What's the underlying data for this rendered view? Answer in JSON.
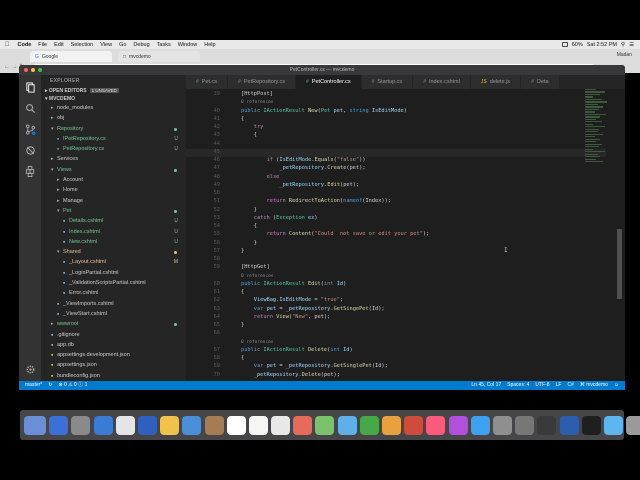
{
  "menubar": {
    "items": [
      "Code",
      "File",
      "Edit",
      "Selection",
      "View",
      "Go",
      "Debug",
      "Tasks",
      "Window",
      "Help"
    ],
    "battery": "60%",
    "clock": "Sat 2:52 PM"
  },
  "browser": {
    "tab1": "Google",
    "tab2": "mvcdemo",
    "user": "Madan"
  },
  "window": {
    "title": "PetController.cs — mvcdemo"
  },
  "sidebar": {
    "header": "EXPLORER",
    "open_editors": "OPEN EDITORS",
    "unsaved": "1 UNSAVED",
    "project": "MVCDEMO",
    "tree": [
      {
        "label": "node_modules",
        "indent": 1,
        "caret": "▸",
        "status": ""
      },
      {
        "label": "obj",
        "indent": 1,
        "caret": "▸",
        "status": ""
      },
      {
        "label": "Repository",
        "indent": 1,
        "caret": "▾",
        "status": "dot",
        "color": "#73c991"
      },
      {
        "label": "IPetRepository.cs",
        "indent": 2,
        "caret": "",
        "status": "U",
        "color": "#73c991"
      },
      {
        "label": "PetRepository.cs",
        "indent": 2,
        "caret": "",
        "status": "U",
        "color": "#73c991"
      },
      {
        "label": "Services",
        "indent": 1,
        "caret": "▸",
        "status": ""
      },
      {
        "label": "Views",
        "indent": 1,
        "caret": "▾",
        "status": "dot",
        "color": "#73c991"
      },
      {
        "label": "Account",
        "indent": 2,
        "caret": "▸",
        "status": ""
      },
      {
        "label": "Home",
        "indent": 2,
        "caret": "▸",
        "status": ""
      },
      {
        "label": "Manage",
        "indent": 2,
        "caret": "▸",
        "status": ""
      },
      {
        "label": "Pet",
        "indent": 2,
        "caret": "▾",
        "status": "dot",
        "color": "#73c991"
      },
      {
        "label": "Details.cshtml",
        "indent": 3,
        "caret": "",
        "status": "U",
        "color": "#73c991"
      },
      {
        "label": "Index.cshtml",
        "indent": 3,
        "caret": "",
        "status": "U",
        "color": "#73c991"
      },
      {
        "label": "New.cshtml",
        "indent": 3,
        "caret": "",
        "status": "U",
        "color": "#73c991"
      },
      {
        "label": "Shared",
        "indent": 2,
        "caret": "▾",
        "status": "dot",
        "color": "#e2c08d"
      },
      {
        "label": "_Layout.cshtml",
        "indent": 3,
        "caret": "",
        "status": "M",
        "color": "#e2c08d"
      },
      {
        "label": "_LoginPartial.cshtml",
        "indent": 3,
        "caret": "",
        "status": ""
      },
      {
        "label": "_ValidationScriptsPartial.cshtml",
        "indent": 3,
        "caret": "",
        "status": ""
      },
      {
        "label": "Error.cshtml",
        "indent": 3,
        "caret": "",
        "status": ""
      },
      {
        "label": "_ViewImports.cshtml",
        "indent": 2,
        "caret": "",
        "status": ""
      },
      {
        "label": "_ViewStart.cshtml",
        "indent": 2,
        "caret": "",
        "status": ""
      },
      {
        "label": "wwwroot",
        "indent": 1,
        "caret": "▸",
        "status": "dot",
        "color": "#73c991"
      },
      {
        "label": ".gitignore",
        "indent": 1,
        "caret": "",
        "status": ""
      },
      {
        "label": "app.db",
        "indent": 1,
        "caret": "",
        "status": ""
      },
      {
        "label": "appsettings.development.json",
        "indent": 1,
        "caret": "",
        "status": ""
      },
      {
        "label": "appsettings.json",
        "indent": 1,
        "caret": "",
        "status": ""
      },
      {
        "label": "bundleconfig.json",
        "indent": 1,
        "caret": "",
        "status": ""
      }
    ]
  },
  "tabs": [
    {
      "label": "Pet.cs",
      "type": "cs",
      "active": false
    },
    {
      "label": "PetRepository.cs",
      "type": "cs",
      "active": false
    },
    {
      "label": "PetController.cs",
      "type": "cs",
      "active": true
    },
    {
      "label": "Startup.cs",
      "type": "cs",
      "active": false
    },
    {
      "label": "Index.cshtml",
      "type": "cs",
      "active": false
    },
    {
      "label": "delete.js",
      "type": "js",
      "active": false
    },
    {
      "label": "Deta",
      "type": "cs",
      "active": false
    }
  ],
  "code": [
    {
      "n": "39",
      "ind": 4,
      "toks": [
        [
          "pl",
          "[HttpPost]"
        ]
      ]
    },
    {
      "n": "",
      "ind": 4,
      "ref": "0 references"
    },
    {
      "n": "40",
      "ind": 4,
      "toks": [
        [
          "kw",
          "public "
        ],
        [
          "ty",
          "IActionResult "
        ],
        [
          "fn",
          "New"
        ],
        [
          "pl",
          "("
        ],
        [
          "ty",
          "Pet "
        ],
        [
          "vr",
          "pet"
        ],
        [
          "pl",
          ", "
        ],
        [
          "kw",
          "string "
        ],
        [
          "vr",
          "IsEditMode"
        ],
        [
          "pl",
          ")"
        ]
      ]
    },
    {
      "n": "41",
      "ind": 4,
      "toks": [
        [
          "pl",
          "{"
        ]
      ]
    },
    {
      "n": "42",
      "ind": 8,
      "toks": [
        [
          "kc",
          "try"
        ]
      ]
    },
    {
      "n": "43",
      "ind": 8,
      "toks": [
        [
          "pl",
          "{"
        ]
      ]
    },
    {
      "n": "44",
      "ind": 12,
      "toks": [
        [
          "pl",
          ""
        ]
      ]
    },
    {
      "n": "45",
      "ind": 12,
      "toks": [
        [
          "pl",
          ""
        ]
      ],
      "cur": true
    },
    {
      "n": "46",
      "ind": 12,
      "toks": [
        [
          "kc",
          "if "
        ],
        [
          "pl",
          "("
        ],
        [
          "vr",
          "IsEditMode"
        ],
        [
          "pl",
          "."
        ],
        [
          "fn",
          "Equals"
        ],
        [
          "pl",
          "("
        ],
        [
          "st",
          "\"false\""
        ],
        [
          "pl",
          "))"
        ]
      ]
    },
    {
      "n": "47",
      "ind": 16,
      "toks": [
        [
          "vr",
          "_petRepository"
        ],
        [
          "pl",
          "."
        ],
        [
          "fn",
          "Create"
        ],
        [
          "pl",
          "(pet);"
        ]
      ]
    },
    {
      "n": "48",
      "ind": 12,
      "toks": [
        [
          "kc",
          "else"
        ]
      ]
    },
    {
      "n": "49",
      "ind": 16,
      "toks": [
        [
          "vr",
          "_petRepository"
        ],
        [
          "pl",
          "."
        ],
        [
          "fn",
          "Edit"
        ],
        [
          "pl",
          "(pet);"
        ]
      ]
    },
    {
      "n": "50",
      "ind": 12,
      "toks": [
        [
          "pl",
          ""
        ]
      ]
    },
    {
      "n": "51",
      "ind": 12,
      "toks": [
        [
          "kc",
          "return "
        ],
        [
          "fn",
          "RedirectToAction"
        ],
        [
          "pl",
          "("
        ],
        [
          "kw",
          "nameof"
        ],
        [
          "pl",
          "(Index));"
        ]
      ]
    },
    {
      "n": "52",
      "ind": 8,
      "toks": [
        [
          "pl",
          "}"
        ]
      ]
    },
    {
      "n": "53",
      "ind": 8,
      "toks": [
        [
          "kc",
          "catch "
        ],
        [
          "pl",
          "("
        ],
        [
          "ty",
          "Exception "
        ],
        [
          "vr",
          "ex"
        ],
        [
          "pl",
          ")"
        ]
      ]
    },
    {
      "n": "54",
      "ind": 8,
      "toks": [
        [
          "pl",
          "{"
        ]
      ]
    },
    {
      "n": "55",
      "ind": 12,
      "toks": [
        [
          "kc",
          "return "
        ],
        [
          "fn",
          "Content"
        ],
        [
          "pl",
          "("
        ],
        [
          "st",
          "\"Could  not save or edit your pet\""
        ],
        [
          "pl",
          ");"
        ]
      ]
    },
    {
      "n": "56",
      "ind": 8,
      "toks": [
        [
          "pl",
          "}"
        ]
      ]
    },
    {
      "n": "57",
      "ind": 4,
      "toks": [
        [
          "pl",
          "}"
        ]
      ]
    },
    {
      "n": "58",
      "ind": 4,
      "toks": [
        [
          "pl",
          ""
        ]
      ]
    },
    {
      "n": "59",
      "ind": 4,
      "toks": [
        [
          "pl",
          "[HttpGet]"
        ]
      ]
    },
    {
      "n": "",
      "ind": 4,
      "ref": "0 references"
    },
    {
      "n": "60",
      "ind": 4,
      "toks": [
        [
          "kw",
          "public "
        ],
        [
          "ty",
          "IActionResult "
        ],
        [
          "fn",
          "Edit"
        ],
        [
          "pl",
          "("
        ],
        [
          "kw",
          "int "
        ],
        [
          "vr",
          "Id"
        ],
        [
          "pl",
          ")"
        ]
      ]
    },
    {
      "n": "61",
      "ind": 4,
      "toks": [
        [
          "pl",
          "{"
        ]
      ]
    },
    {
      "n": "62",
      "ind": 8,
      "toks": [
        [
          "vr",
          "ViewBag"
        ],
        [
          "pl",
          "."
        ],
        [
          "vr",
          "IsEditMode"
        ],
        [
          "pl",
          " = "
        ],
        [
          "st",
          "\"true\""
        ],
        [
          "pl",
          ";"
        ]
      ]
    },
    {
      "n": "63",
      "ind": 8,
      "toks": [
        [
          "kw",
          "var "
        ],
        [
          "vr",
          "pet"
        ],
        [
          "pl",
          " = "
        ],
        [
          "vr",
          "_petRepository"
        ],
        [
          "pl",
          "."
        ],
        [
          "fn",
          "GetSingePet"
        ],
        [
          "pl",
          "(Id);"
        ]
      ]
    },
    {
      "n": "64",
      "ind": 8,
      "toks": [
        [
          "kc",
          "return "
        ],
        [
          "fn",
          "View"
        ],
        [
          "pl",
          "("
        ],
        [
          "st",
          "\"New\""
        ],
        [
          "pl",
          ", pet);"
        ]
      ]
    },
    {
      "n": "65",
      "ind": 4,
      "toks": [
        [
          "pl",
          "}"
        ]
      ]
    },
    {
      "n": "66",
      "ind": 4,
      "toks": [
        [
          "pl",
          ""
        ]
      ]
    },
    {
      "n": "",
      "ind": 4,
      "ref": "0 references"
    },
    {
      "n": "67",
      "ind": 4,
      "toks": [
        [
          "kw",
          "public "
        ],
        [
          "ty",
          "IActionResult "
        ],
        [
          "fn",
          "Delete"
        ],
        [
          "pl",
          "("
        ],
        [
          "kw",
          "int "
        ],
        [
          "vr",
          "Id"
        ],
        [
          "pl",
          ")"
        ]
      ]
    },
    {
      "n": "68",
      "ind": 4,
      "toks": [
        [
          "pl",
          "{"
        ]
      ]
    },
    {
      "n": "69",
      "ind": 8,
      "toks": [
        [
          "kw",
          "var "
        ],
        [
          "vr",
          "pet"
        ],
        [
          "pl",
          " = "
        ],
        [
          "vr",
          "_petRepository"
        ],
        [
          "pl",
          "."
        ],
        [
          "fn",
          "GetSinglePet"
        ],
        [
          "pl",
          "(Id);"
        ]
      ]
    },
    {
      "n": "70",
      "ind": 8,
      "toks": [
        [
          "vr",
          "_petRepository"
        ],
        [
          "pl",
          "."
        ],
        [
          "fn",
          "Delete"
        ],
        [
          "pl",
          "(pet);"
        ]
      ]
    }
  ],
  "statusbar": {
    "branch": "master*",
    "sync": "↻",
    "problems": "⊗ 0  ⚠ 0  ⓘ 1",
    "position": "Ln 45, Col 17",
    "spaces": "Spaces: 4",
    "encoding": "UTF-8",
    "eol": "LF",
    "language": "C#",
    "project": "⌘ mvcdemo"
  },
  "dock_colors": [
    "#6b8fd6",
    "#3d6fd8",
    "#8a8a8a",
    "#3a7bd5",
    "#e5e5e5",
    "#2f5fbf",
    "#f0c14b",
    "#4a90d9",
    "#a67c52",
    "#ffffff",
    "#f5f5f5",
    "#e8e8e8",
    "#e86a5b",
    "#7ac36a",
    "#5fb0e8",
    "#46a846",
    "#e8a23d",
    "#cf4b3b",
    "#fa5b7d",
    "#b24fdf",
    "#3ea0f0",
    "#8f8f8f",
    "#777777",
    "#3a3a3a",
    "#2b5fae",
    "#1f1f1f",
    "#5cb6f0",
    "#9a9a9a"
  ],
  "colors": {
    "accent": "#007acc",
    "activity": "#333333",
    "sidebar": "#252526",
    "editor": "#1e1e1e"
  }
}
